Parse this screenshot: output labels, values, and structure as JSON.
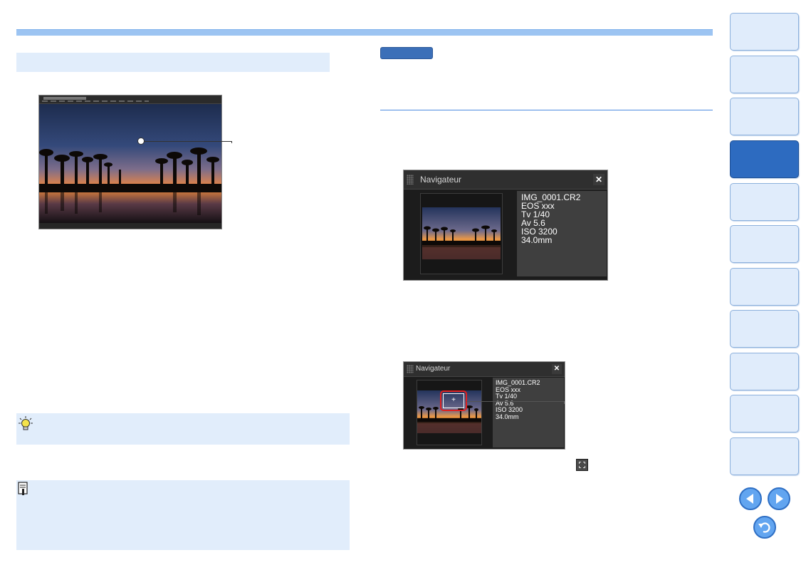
{
  "left_photo_window": {
    "menu_icons": "menu-bar"
  },
  "navigator_large": {
    "title": "Navigateur",
    "close_glyph": "✕",
    "info_lines": [
      "IMG_0001.CR2",
      "EOS xxx",
      "Tv 1/40",
      "Av 5.6",
      "ISO 3200",
      "34.0mm"
    ]
  },
  "navigator_small": {
    "title": "Navigateur",
    "close_glyph": "✕",
    "zoom_marker": "+",
    "info_lines": [
      "IMG_0001.CR2",
      "EOS xxx",
      "Tv 1/40",
      "Av 5.6",
      "ISO 3200",
      "34.0mm"
    ]
  },
  "icons": {
    "tip": "lightbulb-icon",
    "note": "memo-icon",
    "fit": "zoom-fit-icon",
    "prev": "arrow-left-icon",
    "next": "arrow-right-icon",
    "back": "return-icon"
  },
  "colors": {
    "accent": "#2d6bc0",
    "light_box": "#e1edfb",
    "zoom_frame": "#e02020"
  },
  "side_tabs": {
    "count": 11,
    "active_index": 3
  }
}
